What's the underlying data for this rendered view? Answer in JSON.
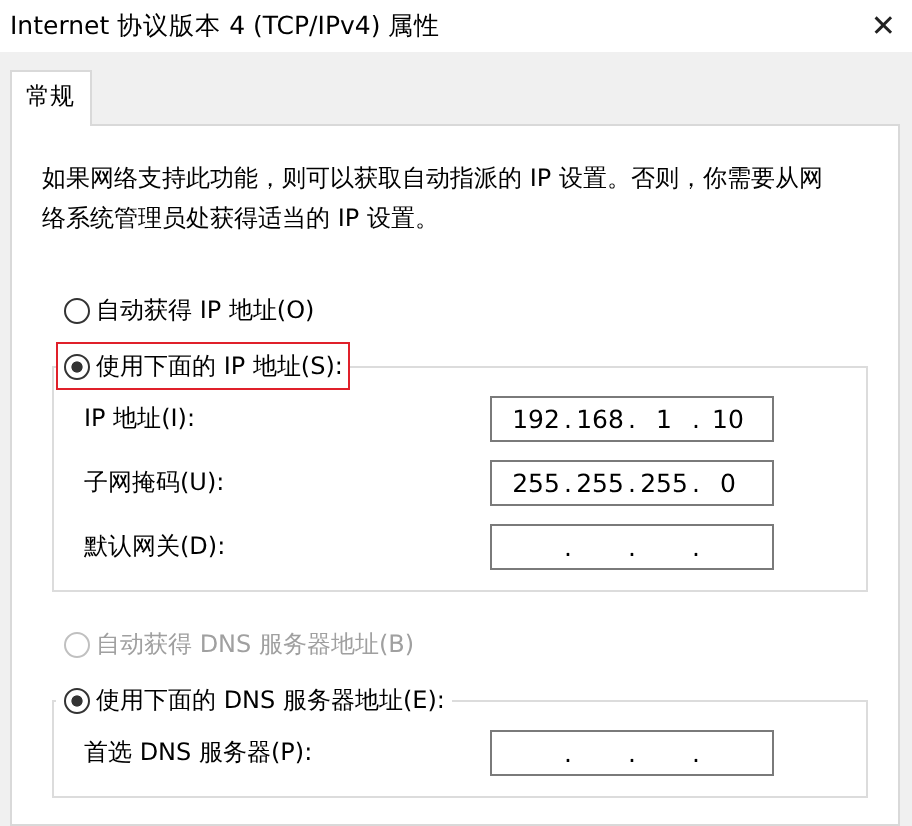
{
  "window": {
    "title": "Internet 协议版本 4 (TCP/IPv4) 属性",
    "close": "✕"
  },
  "tabs": [
    {
      "label": "常规",
      "selected": true
    }
  ],
  "description": "如果网络支持此功能，则可以获取自动指派的 IP 设置。否则，你需要从网络系统管理员处获得适当的 IP 设置。",
  "separator": ".",
  "ip_section": {
    "options": [
      {
        "label": "自动获得 IP 地址(O)",
        "selected": false,
        "disabled": false,
        "highlighted": false
      },
      {
        "label": "使用下面的 IP 地址(S):",
        "selected": true,
        "disabled": false,
        "highlighted": true
      }
    ],
    "fields": [
      {
        "label": "IP 地址(I):",
        "octets": [
          "192",
          "168",
          "1",
          "10"
        ]
      },
      {
        "label": "子网掩码(U):",
        "octets": [
          "255",
          "255",
          "255",
          "0"
        ]
      },
      {
        "label": "默认网关(D):"
      }
    ]
  },
  "dns_section": {
    "options": [
      {
        "label": "自动获得 DNS 服务器地址(B)",
        "selected": false,
        "disabled": true,
        "highlighted": false
      },
      {
        "label": "使用下面的 DNS 服务器地址(E):",
        "selected": true,
        "disabled": false,
        "highlighted": false
      }
    ],
    "fields": [
      {
        "label": "首选 DNS 服务器(P):"
      }
    ]
  }
}
